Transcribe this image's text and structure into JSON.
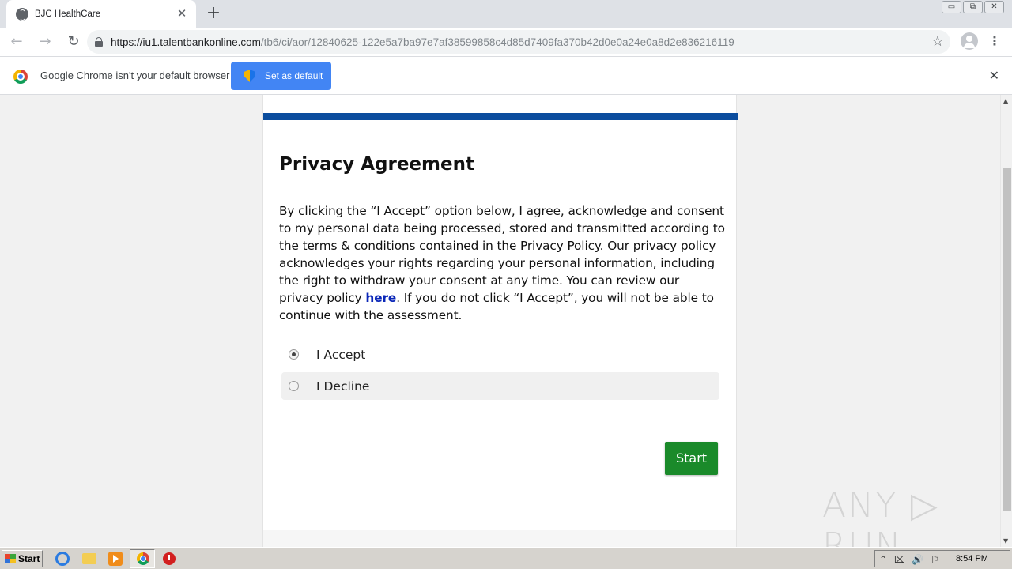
{
  "browser": {
    "tab_title": "BJC HealthCare",
    "tab_close": "✕",
    "new_tab": "+",
    "url_domain": "https://iu1.talentbankonline.com",
    "url_path": "/tb6/ci/aor/12840625-122e5a7ba97e7af38599858c4d85d7409fa370b42d0e0a24e0a8d2e836216119",
    "back": "←",
    "forward": "→",
    "reload": "↻",
    "star": "☆",
    "menu": "⋮",
    "window_minimize": "▭",
    "window_restore": "⧉",
    "window_close": "✕"
  },
  "infobar": {
    "message": "Google Chrome isn't your default browser",
    "button_label": "Set as default",
    "close": "✕"
  },
  "page": {
    "accent_color": "#0b4d9e",
    "title": "Privacy Agreement",
    "body_part1": "By clicking the “I Accept” option below, I agree, acknowledge and consent to my personal data being processed, stored and transmitted according to the terms & conditions contained in the Privacy Policy. Our privacy policy acknowledges your rights regarding your personal information, including the right to withdraw your consent at any time. You can review our privacy policy ",
    "link_text": "here",
    "body_part2": ". If you do not click “I Accept”, you will not be able to continue with the assessment.",
    "options": [
      {
        "label": "I Accept",
        "selected": true
      },
      {
        "label": "I Decline",
        "selected": false
      }
    ],
    "start_button": "Start",
    "start_color": "#1a8a2a"
  },
  "watermark": "ANY ▷ RUN",
  "taskbar": {
    "start_label": "Start",
    "clock": "8:54 PM",
    "tray_icons": [
      "⌃",
      "⌧",
      "🔊",
      "⚐"
    ]
  }
}
